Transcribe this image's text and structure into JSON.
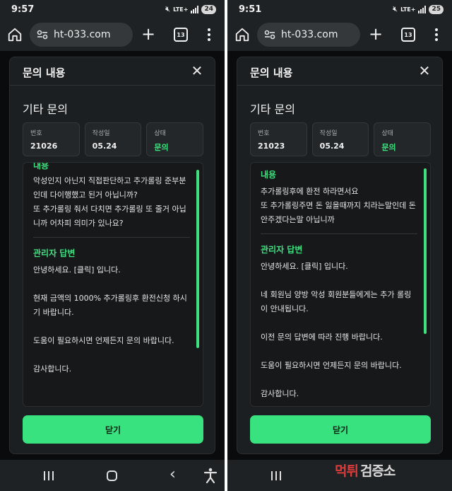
{
  "screens": [
    {
      "status_time": "9:57",
      "battery": "24",
      "network": "LTE+",
      "url": "ht-033.com",
      "tab_count": "13",
      "modal_title": "문의 내용",
      "category": "기타 문의",
      "number_label": "번호",
      "number": "21026",
      "date_label": "작성일",
      "date": "05.24",
      "status_label": "상태",
      "status": "문의",
      "content_title": "내용",
      "content_text": "악성인지 아닌지 직접판단하고 추가롤링 준부분인데 다이행했고 된거 아닙니까?\n또 추가롤링 줘서 다치면 추가롤링 또 줄거 아닙니까 어차피 의미가 있나요?",
      "reply_title": "관리자 답변",
      "reply_text": "안녕하세요. [클릭] 입니다.\n\n현재 금액의 1000% 추가롤링후 환전신청 하시기 바랍니다.\n\n도움이 필요하시면 언제든지 문의 바랍니다.\n\n감사합니다.",
      "close_button": "닫기"
    },
    {
      "status_time": "9:51",
      "battery": "25",
      "network": "LTE+",
      "url": "ht-033.com",
      "tab_count": "13",
      "modal_title": "문의 내용",
      "category": "기타 문의",
      "number_label": "번호",
      "number": "21023",
      "date_label": "작성일",
      "date": "05.24",
      "status_label": "상태",
      "status": "문의",
      "content_title": "내용",
      "content_text": "추가롤링후에 환전 하라면서요\n또 추가롤링주면 돈 잃을때까지 치라는말인데 돈안주겠다는말 아닙니까",
      "reply_title": "관리자 답변",
      "reply_text": "안녕하세요. [클릭] 입니다.\n\n네 회원님 양방 악성 회원분들에게는 추가 롤링이 안내됩니다.\n\n이전 문의 답변에 따라 진행 바랍니다.\n\n도움이 필요하시면 언제든지 문의 바랍니다.\n\n감사합니다.",
      "close_button": "닫기"
    }
  ],
  "watermark": {
    "part1": "먹튀",
    "part2": "검증소"
  },
  "colors": {
    "accent": "#37e27f",
    "status_green": "#3ee07f",
    "modal_bg": "#1c1f21",
    "page_bg": "#0d0f10"
  },
  "icons": [
    "home-icon",
    "site-settings-icon",
    "new-tab-icon",
    "tab-switcher-icon",
    "more-menu-icon",
    "close-icon",
    "recents-icon",
    "home-nav-icon",
    "back-icon",
    "accessibility-icon",
    "mute-icon",
    "signal-icon",
    "battery-icon"
  ]
}
